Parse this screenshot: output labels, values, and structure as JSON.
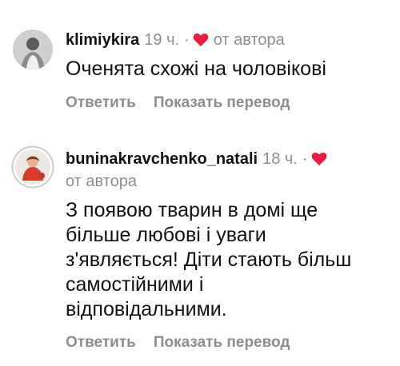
{
  "comments": [
    {
      "username": "klimiykira",
      "time": "19 ч.",
      "separator": "·",
      "by_author": "от автора",
      "text": "Оченята схожі на чоловікові",
      "reply_label": "Ответить",
      "translate_label": "Показать перевод"
    },
    {
      "username": "buninakravchenko_natali",
      "time": "18 ч.",
      "separator": "·",
      "by_author": "от автора",
      "text_lines": [
        "З появою тварин в домі ще",
        "більше любові і уваги",
        "з'являється! Діти стають більш",
        "самостійними і",
        "відповідальними."
      ],
      "reply_label": "Ответить",
      "translate_label": "Показать перевод"
    }
  ],
  "colors": {
    "heart": "#ed1c3c",
    "muted": "#8e8e8e",
    "text": "#111111"
  }
}
